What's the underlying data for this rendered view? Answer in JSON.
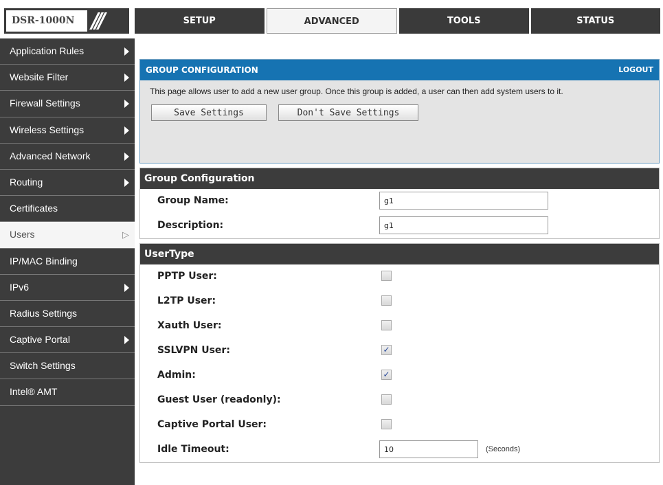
{
  "header": {
    "model": "DSR-1000N",
    "slashes": "///",
    "tabs": [
      {
        "label": "SETUP",
        "active": false
      },
      {
        "label": "ADVANCED",
        "active": true
      },
      {
        "label": "TOOLS",
        "active": false
      },
      {
        "label": "STATUS",
        "active": false
      }
    ]
  },
  "sidebar": {
    "items": [
      {
        "label": "Application Rules",
        "arrow": true
      },
      {
        "label": "Website Filter",
        "arrow": true
      },
      {
        "label": "Firewall Settings",
        "arrow": true
      },
      {
        "label": "Wireless Settings",
        "arrow": true
      },
      {
        "label": "Advanced Network",
        "arrow": true
      },
      {
        "label": "Routing",
        "arrow": true
      },
      {
        "label": "Certificates",
        "arrow": false
      },
      {
        "label": "Users",
        "arrow": true,
        "active": true
      },
      {
        "label": "IP/MAC Binding",
        "arrow": false
      },
      {
        "label": "IPv6",
        "arrow": true
      },
      {
        "label": "Radius Settings",
        "arrow": false
      },
      {
        "label": "Captive Portal",
        "arrow": true
      },
      {
        "label": "Switch Settings",
        "arrow": false
      },
      {
        "label": "Intel® AMT",
        "arrow": false
      }
    ]
  },
  "group_box": {
    "title": "GROUP CONFIGURATION",
    "logout": "LOGOUT",
    "description": "This page allows user to add a new user group. Once this group is added, a user can then add system users to it.",
    "save_label": "Save Settings",
    "dont_save_label": "Don't Save Settings"
  },
  "group_config": {
    "header": "Group Configuration",
    "group_name_label": "Group Name:",
    "group_name_value": "g1",
    "description_label": "Description:",
    "description_value": "g1"
  },
  "user_type": {
    "header": "UserType",
    "pptp_label": "PPTP User:",
    "pptp_checked": false,
    "l2tp_label": "L2TP User:",
    "l2tp_checked": false,
    "xauth_label": "Xauth User:",
    "xauth_checked": false,
    "sslvpn_label": "SSLVPN User:",
    "sslvpn_checked": true,
    "admin_label": "Admin:",
    "admin_checked": true,
    "guest_label": "Guest User (readonly):",
    "guest_checked": false,
    "captive_label": "Captive Portal User:",
    "captive_checked": false,
    "idle_label": "Idle Timeout:",
    "idle_value": "10",
    "idle_unit": "(Seconds)"
  },
  "colors": {
    "header_blue": "#1673b2",
    "dark_bar": "#3c3c3c",
    "panel_gray": "#e4e4e4"
  }
}
